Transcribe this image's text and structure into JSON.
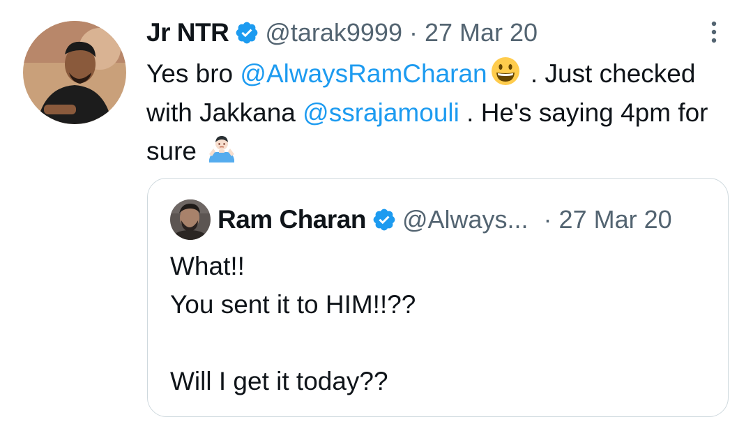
{
  "tweet": {
    "author": {
      "display_name": "Jr NTR",
      "handle": "@tarak9999",
      "verified": true
    },
    "separator": "·",
    "date": "27 Mar 20",
    "more_icon": "more-vertical-icon",
    "text": {
      "part1": "Yes bro ",
      "mention1": "@AlwaysRamCharan",
      "emoji1": "grinning-face-emoji",
      "part2": " . Just checked with Jakkana ",
      "mention2": "@ssrajamouli",
      "part3": " . He's saying 4pm for sure ",
      "emoji2": "person-shrugging-emoji"
    }
  },
  "quote": {
    "author": {
      "display_name": "Ram Charan",
      "handle": "@Always...",
      "verified": true
    },
    "separator": "·",
    "date": "27 Mar 20",
    "lines": [
      "What!!",
      "You sent it to HIM!!??",
      "",
      "Will I get it today??"
    ]
  },
  "colors": {
    "link": "#1d9bf0",
    "secondary_text": "#536471",
    "border": "#cfd9de",
    "verified_badge": "#1d9bf0"
  }
}
